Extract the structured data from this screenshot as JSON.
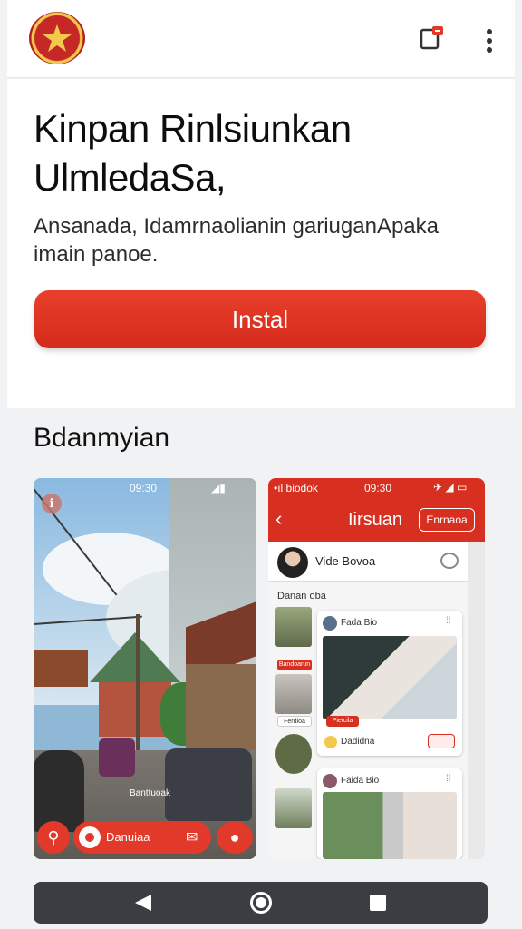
{
  "header": {
    "logo_icon": "garuda-star-emblem-icon",
    "share_icon": "share-icon",
    "more_icon": "more-vertical-icon"
  },
  "hero": {
    "headline": "Kinpan Rinlsiunkan UlmledaSa,",
    "description": "Ansanada, Idamrnaolianin gariuganApaka imain panoe.",
    "install_label": "Instal"
  },
  "screenshots": {
    "title": "Bdanmyian",
    "shot1": {
      "status_time": "09:30",
      "caption": "Banttuoak",
      "pill_label": "Danuiaa"
    },
    "shot2": {
      "status_left": "•ıl biodok",
      "status_time": "09:30",
      "appbar_title": "Iirsuan",
      "appbar_chip": "Enrnaoa",
      "profile_name": "Vide Bovoa",
      "section_label": "Danan oba",
      "thumb_badge_1": "Bandoarun",
      "thumb_badge_2": "Ferdioa",
      "card1_name": "Fada Bio",
      "card1_tag": "Pietcila",
      "card1_footer": "Dadidna",
      "card2_name": "Faida Bio"
    }
  },
  "navigation": {
    "back_icon": "back-triangle-icon",
    "home_icon": "home-circle-icon",
    "recent_icon": "recent-apps-square-icon"
  },
  "colors": {
    "accent": "#d72f20",
    "navbar": "#3a3d42"
  }
}
